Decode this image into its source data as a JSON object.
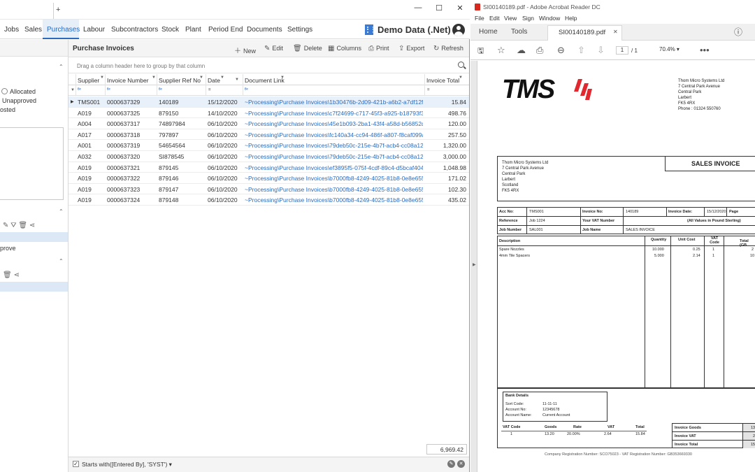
{
  "app": {
    "menu": [
      "Jobs",
      "Sales",
      "Purchases",
      "Labour",
      "Subcontractors",
      "Stock",
      "Plant",
      "Period End",
      "Documents",
      "Settings"
    ],
    "active_menu": "Purchases",
    "org_title": "Demo Data (.Net)"
  },
  "sidebar": {
    "radio_allocated": "Allocated",
    "radio_unapproved": "Unapproved",
    "radio_posted": "osted",
    "approve_text": "prove"
  },
  "panel": {
    "title": "Purchase Invoices",
    "toolbar": {
      "new": "New",
      "edit": "Edit",
      "delete": "Delete",
      "columns": "Columns",
      "print": "Print",
      "export": "Export",
      "refresh": "Refresh"
    },
    "group_hint": "Drag a column header here to group by that column",
    "columns": [
      "Supplier",
      "Invoice Number",
      "Supplier Ref No",
      "Date",
      "Document Link",
      "Invoice Total"
    ],
    "rows": [
      {
        "supplier": "TMS001",
        "invoice": "0000637329",
        "ref": "140189",
        "date": "15/12/2020",
        "link": "~Processing\\Purchase Invoices\\1b30476b-2d09-421b-a6b2-a7df12fdc6f...",
        "total": "15.84"
      },
      {
        "supplier": "A019",
        "invoice": "0000637325",
        "ref": "879150",
        "date": "14/10/2020",
        "link": "~Processing\\Purchase Invoices\\c7f24699-c717-45f3-a925-b18793f3ac80...",
        "total": "498.76"
      },
      {
        "supplier": "A004",
        "invoice": "0000637317",
        "ref": "74897984",
        "date": "06/10/2020",
        "link": "~Processing\\Purchase Invoices\\45e1b093-2ba1-43f4-a58d-b56852dc93...",
        "total": "120.00"
      },
      {
        "supplier": "A017",
        "invoice": "0000637318",
        "ref": "797897",
        "date": "06/10/2020",
        "link": "~Processing\\Purchase Invoices\\fc140a34-cc94-486f-a807-f8caf099ab39\\...",
        "total": "257.50"
      },
      {
        "supplier": "A001",
        "invoice": "0000637319",
        "ref": "54654564",
        "date": "06/10/2020",
        "link": "~Processing\\Purchase Invoices\\79deb50c-215e-4b7f-acb4-cc08a12b2c8...",
        "total": "1,320.00"
      },
      {
        "supplier": "A032",
        "invoice": "0000637320",
        "ref": "SI878545",
        "date": "06/10/2020",
        "link": "~Processing\\Purchase Invoices\\79deb50c-215e-4b7f-acb4-cc08a12b2c8...",
        "total": "3,000.00"
      },
      {
        "supplier": "A019",
        "invoice": "0000637321",
        "ref": "879145",
        "date": "06/10/2020",
        "link": "~Processing\\Purchase Invoices\\ef3895f5-075f-4cdf-89c4-d5bcaf40430a\\...",
        "total": "1,048.98"
      },
      {
        "supplier": "A019",
        "invoice": "0000637322",
        "ref": "879146",
        "date": "06/10/2020",
        "link": "~Processing\\Purchase Invoices\\b7000fb8-4249-4025-81b8-0e8e6551da...",
        "total": "171.02"
      },
      {
        "supplier": "A019",
        "invoice": "0000637323",
        "ref": "879147",
        "date": "06/10/2020",
        "link": "~Processing\\Purchase Invoices\\b7000fb8-4249-4025-81b8-0e8e6551da...",
        "total": "102.30"
      },
      {
        "supplier": "A019",
        "invoice": "0000637324",
        "ref": "879148",
        "date": "06/10/2020",
        "link": "~Processing\\Purchase Invoices\\b7000fb8-4249-4025-81b8-0e8e6551da...",
        "total": "435.02"
      }
    ],
    "grand_total": "6,969.42",
    "filter_text": "Starts with([Entered By], 'SYST')"
  },
  "pdf": {
    "window_title": "SI00140189.pdf - Adobe Acrobat Reader DC",
    "menu": [
      "File",
      "Edit",
      "View",
      "Sign",
      "Window",
      "Help"
    ],
    "tab_home": "Home",
    "tab_tools": "Tools",
    "doc_tab": "SI00140189.pdf",
    "page_current": "1",
    "page_total": "/ 1",
    "zoom": "70.4%",
    "doc": {
      "logo": "TMS",
      "company_address": [
        "Thom Micro Systems Ltd",
        "7 Central Park Avenue",
        "Central Park",
        "Larbert",
        "FK5 4RX",
        "Phone : 01324 550760"
      ],
      "title": "SALES INVOICE",
      "bill_to": [
        "Thom Micro Systems Ltd",
        "7 Central Park Avenue",
        "Central Park",
        "Larbert",
        "Scotland",
        "FK5 4RX"
      ],
      "acc_no_label": "Acc No:",
      "acc_no": "TMS001",
      "invoice_no_label": "Invoice No:",
      "invoice_no": "140189",
      "invoice_date_label": "Invoice Date:",
      "invoice_date": "15/12/2020",
      "page_label": "Page",
      "reference_label": "Reference",
      "reference": "Job 1224",
      "vat_number_label": "Your VAT Number",
      "values_note": "(All Values in Pound Sterling)",
      "job_number_label": "Job Number",
      "job_number": "SAL001",
      "job_name_label": "Job Name",
      "job_name": "SALES INVOICE",
      "line_headers": [
        "Description",
        "Quantity",
        "Unit Cost",
        "VAT Code",
        "Total (GB"
      ],
      "lines": [
        {
          "desc": "Spare Nozzles",
          "qty": "10.000",
          "unit": "0.25",
          "vat": "1",
          "total": "2"
        },
        {
          "desc": "4mm Tile Spacers",
          "qty": "5.000",
          "unit": "2.14",
          "vat": "1",
          "total": "10"
        }
      ],
      "bank_title": "Bank Details",
      "sort_code_label": "Sort Code:",
      "sort_code": "11-11-11",
      "account_no_label": "Account No:",
      "account_no": "12345678",
      "account_name_label": "Account Name:",
      "account_name": "Current Account",
      "vat_summary_headers": [
        "VAT Code",
        "Goods",
        "Rate",
        "VAT",
        "Total"
      ],
      "vat_summary": {
        "code": "1",
        "goods": "13.20",
        "rate": "20.00%",
        "vat": "2.64",
        "total": "15.84"
      },
      "invoice_goods_label": "Invoice Goods",
      "invoice_goods": "13",
      "invoice_vat_label": "Invoice VAT",
      "invoice_vat": "2",
      "invoice_total_label": "Invoice Total",
      "invoice_total": "15",
      "footer": "Company Registration Number: SCO75023 - VAT Registration Number: GB353669330"
    }
  },
  "colors": {
    "accent": "#2a6bbf",
    "selection": "#e8f0fa",
    "pdf_red": "#d8281e",
    "logo_red": "#e0282e"
  }
}
